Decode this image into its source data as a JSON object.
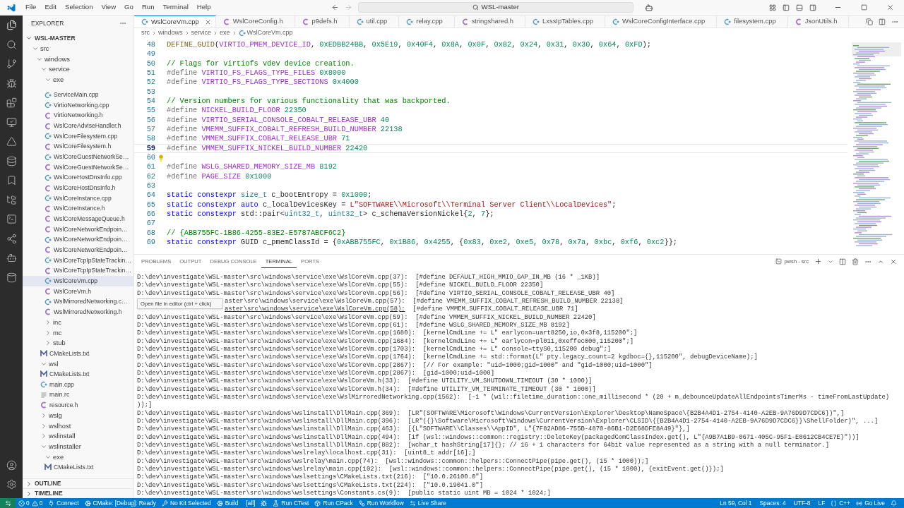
{
  "title_bar": {
    "menu": [
      "File",
      "Edit",
      "Selection",
      "View",
      "Go",
      "Run",
      "Terminal",
      "Help"
    ],
    "search": "WSL-master"
  },
  "explorer": {
    "title": "EXPLORER",
    "root": "WSL-MASTER",
    "tree": [
      {
        "name": "src",
        "kind": "folder",
        "expanded": true,
        "children": [
          {
            "name": "windows",
            "kind": "folder",
            "expanded": true,
            "children": [
              {
                "name": "service",
                "kind": "folder",
                "expanded": true,
                "children": [
                  {
                    "name": "exe",
                    "kind": "folder",
                    "expanded": true,
                    "children": [
                      {
                        "name": "ServiceMain.cpp",
                        "kind": "cpp",
                        "selected": false
                      },
                      {
                        "name": "VirtioNetworking.cpp",
                        "kind": "cpp",
                        "selected": false
                      },
                      {
                        "name": "VirtioNetworking.h",
                        "kind": "h",
                        "selected": false
                      },
                      {
                        "name": "WslCoreAdviseHandler.h",
                        "kind": "h",
                        "selected": false
                      },
                      {
                        "name": "WslCoreFilesystem.cpp",
                        "kind": "cpp",
                        "selected": false
                      },
                      {
                        "name": "WslCoreFilesystem.h",
                        "kind": "h",
                        "selected": false
                      },
                      {
                        "name": "WslCoreGuestNetworkSe…",
                        "kind": "cpp",
                        "selected": false
                      },
                      {
                        "name": "WslCoreGuestNetworkSe…",
                        "kind": "h",
                        "selected": false
                      },
                      {
                        "name": "WslCoreHostDnsInfo.cpp",
                        "kind": "cpp",
                        "selected": false
                      },
                      {
                        "name": "WslCoreHostDnsInfo.h",
                        "kind": "h",
                        "selected": false
                      },
                      {
                        "name": "WslCoreInstance.cpp",
                        "kind": "cpp",
                        "selected": false
                      },
                      {
                        "name": "WslCoreInstance.h",
                        "kind": "h",
                        "selected": false
                      },
                      {
                        "name": "WslCoreMessageQueue.h",
                        "kind": "h",
                        "selected": false
                      },
                      {
                        "name": "WslCoreNetworkEndpoin…",
                        "kind": "h",
                        "selected": false
                      },
                      {
                        "name": "WslCoreNetworkEndpoin…",
                        "kind": "cpp",
                        "selected": false
                      },
                      {
                        "name": "WslCoreNetworkEndpoin…",
                        "kind": "h",
                        "selected": false
                      },
                      {
                        "name": "WslCoreTcpIpStateTrackin…",
                        "kind": "cpp",
                        "selected": false
                      },
                      {
                        "name": "WslCoreTcpIpStateTrackin…",
                        "kind": "h",
                        "selected": false
                      },
                      {
                        "name": "WslCoreVm.cpp",
                        "kind": "cpp",
                        "selected": true
                      },
                      {
                        "name": "WslCoreVm.h",
                        "kind": "h",
                        "selected": false
                      },
                      {
                        "name": "WslMirroredNetworking.c…",
                        "kind": "cpp",
                        "selected": false
                      },
                      {
                        "name": "WslMirroredNetworking.h",
                        "kind": "h",
                        "selected": false
                      }
                    ]
                  },
                  {
                    "name": "inc",
                    "kind": "folder",
                    "expanded": false
                  },
                  {
                    "name": "mc",
                    "kind": "folder",
                    "expanded": false
                  },
                  {
                    "name": "stub",
                    "kind": "folder",
                    "expanded": false
                  },
                  {
                    "name": "CMakeLists.txt",
                    "kind": "cmake",
                    "selected": false
                  }
                ]
              },
              {
                "name": "wsl",
                "kind": "folder",
                "expanded": true,
                "children": [
                  {
                    "name": "CMakeLists.txt",
                    "kind": "cmake",
                    "selected": false
                  },
                  {
                    "name": "main.cpp",
                    "kind": "cpp",
                    "selected": false
                  },
                  {
                    "name": "main.rc",
                    "kind": "rc",
                    "selected": false
                  },
                  {
                    "name": "resource.h",
                    "kind": "h",
                    "selected": false
                  }
                ]
              },
              {
                "name": "wslg",
                "kind": "folder",
                "expanded": false
              },
              {
                "name": "wslhost",
                "kind": "folder",
                "expanded": false
              },
              {
                "name": "wslinstall",
                "kind": "folder",
                "expanded": false
              },
              {
                "name": "wslinstaller",
                "kind": "folder",
                "expanded": true,
                "children": [
                  {
                    "name": "exe",
                    "kind": "folder",
                    "expanded": true,
                    "children": [
                      {
                        "name": "CMakeLists.txt",
                        "kind": "cmake",
                        "selected": false
                      }
                    ]
                  }
                ]
              }
            ]
          }
        ]
      }
    ],
    "sections": [
      {
        "label": "OUTLINE",
        "expanded": false
      },
      {
        "label": "TIMELINE",
        "expanded": false
      }
    ]
  },
  "editor": {
    "tabs": [
      {
        "label": "WslCoreVm.cpp",
        "kind": "cpp",
        "selected": true
      },
      {
        "label": "WslCoreConfig.h",
        "kind": "h",
        "selected": false
      },
      {
        "label": "p9defs.h",
        "kind": "h",
        "selected": false
      },
      {
        "label": "util.cpp",
        "kind": "cpp",
        "selected": false
      },
      {
        "label": "relay.cpp",
        "kind": "cpp",
        "selected": false
      },
      {
        "label": "stringshared.h",
        "kind": "h",
        "selected": false
      },
      {
        "label": "LxssIpTables.cpp",
        "kind": "cpp",
        "selected": false
      },
      {
        "label": "WslCoreConfigInterface.cpp",
        "kind": "cpp",
        "selected": false
      },
      {
        "label": "filesystem.cpp",
        "kind": "cpp",
        "selected": false
      },
      {
        "label": "JsonUtils.h",
        "kind": "h",
        "selected": false
      }
    ],
    "breadcrumbs": [
      "src",
      "windows",
      "service",
      "exe",
      "WslCoreVm.cpp"
    ],
    "lines": [
      {
        "n": "48",
        "current": false,
        "tokens": [
          {
            "kind": "func",
            "text": "DEFINE_GUID"
          },
          {
            "kind": "punct",
            "text": "("
          },
          {
            "kind": "macro",
            "text": "VIRTIO_PMEM_DEVICE_ID"
          },
          {
            "kind": "punct",
            "text": ", "
          },
          {
            "kind": "num",
            "text": "0xEDBB24BB"
          },
          {
            "kind": "punct",
            "text": ", "
          },
          {
            "kind": "num",
            "text": "0x5E19"
          },
          {
            "kind": "punct",
            "text": ", "
          },
          {
            "kind": "num",
            "text": "0x40F4"
          },
          {
            "kind": "punct",
            "text": ", "
          },
          {
            "kind": "num",
            "text": "0x8A"
          },
          {
            "kind": "punct",
            "text": ", "
          },
          {
            "kind": "num",
            "text": "0x0F"
          },
          {
            "kind": "punct",
            "text": ", "
          },
          {
            "kind": "num",
            "text": "0x82"
          },
          {
            "kind": "punct",
            "text": ", "
          },
          {
            "kind": "num",
            "text": "0x24"
          },
          {
            "kind": "punct",
            "text": ", "
          },
          {
            "kind": "num",
            "text": "0x31"
          },
          {
            "kind": "punct",
            "text": ", "
          },
          {
            "kind": "num",
            "text": "0x30"
          },
          {
            "kind": "punct",
            "text": ", "
          },
          {
            "kind": "num",
            "text": "0x64"
          },
          {
            "kind": "punct",
            "text": ", "
          },
          {
            "kind": "num",
            "text": "0xFD"
          },
          {
            "kind": "punct",
            "text": ");"
          }
        ]
      },
      {
        "n": "49",
        "current": false
      },
      {
        "n": "50",
        "current": false,
        "tokens": [
          {
            "kind": "comment",
            "text": "// Flags for virtiofs vdev device creation."
          }
        ]
      },
      {
        "n": "51",
        "current": false,
        "tokens": [
          {
            "kind": "pre",
            "text": "#define"
          },
          {
            "kind": "macro",
            "text": " VIRTIO_FS_FLAGS_TYPE_FILES"
          },
          {
            "kind": "num",
            "text": " 0x8000"
          }
        ]
      },
      {
        "n": "52",
        "current": false,
        "tokens": [
          {
            "kind": "pre",
            "text": "#define"
          },
          {
            "kind": "macro",
            "text": " VIRTIO_FS_FLAGS_TYPE_SECTIONS"
          },
          {
            "kind": "num",
            "text": " 0x4000"
          }
        ]
      },
      {
        "n": "53",
        "current": false
      },
      {
        "n": "54",
        "current": false,
        "tokens": [
          {
            "kind": "comment",
            "text": "// Version numbers for various functionality that was backported."
          }
        ]
      },
      {
        "n": "55",
        "current": false,
        "tokens": [
          {
            "kind": "pre",
            "text": "#define"
          },
          {
            "kind": "macro",
            "text": " NICKEL_BUILD_FLOOR"
          },
          {
            "kind": "num",
            "text": " 22350"
          }
        ]
      },
      {
        "n": "56",
        "current": false,
        "tokens": [
          {
            "kind": "pre",
            "text": "#define"
          },
          {
            "kind": "macro",
            "text": " VIRTIO_SERIAL_CONSOLE_COBALT_RELEASE_UBR"
          },
          {
            "kind": "num",
            "text": " 40"
          }
        ]
      },
      {
        "n": "57",
        "current": false,
        "tokens": [
          {
            "kind": "pre",
            "text": "#define"
          },
          {
            "kind": "macro",
            "text": " VMEMM_SUFFIX_COBALT_REFRESH_BUILD_NUMBER"
          },
          {
            "kind": "num",
            "text": " 22138"
          }
        ]
      },
      {
        "n": "58",
        "current": false,
        "tokens": [
          {
            "kind": "pre",
            "text": "#define"
          },
          {
            "kind": "macro",
            "text": " VMMEM_SUFFIX_COBALT_RELEASE_UBR"
          },
          {
            "kind": "num",
            "text": " 71"
          }
        ]
      },
      {
        "n": "59",
        "current": true,
        "tokens": [
          {
            "kind": "pre",
            "text": "#define"
          },
          {
            "kind": "macro",
            "text": " VMMEM_SUFFIX_NICKEL_BUILD_NUMBER"
          },
          {
            "kind": "num",
            "text": " 22420"
          }
        ]
      },
      {
        "n": "60",
        "current": false,
        "bulb": true
      },
      {
        "n": "61",
        "current": false,
        "tokens": [
          {
            "kind": "pre",
            "text": "#define"
          },
          {
            "kind": "macro",
            "text": " WSLG_SHARED_MEMORY_SIZE_MB"
          },
          {
            "kind": "num",
            "text": " 8192"
          }
        ]
      },
      {
        "n": "62",
        "current": false,
        "tokens": [
          {
            "kind": "pre",
            "text": "#define"
          },
          {
            "kind": "macro",
            "text": " PAGE_SIZE"
          },
          {
            "kind": "num",
            "text": " 0x1000"
          }
        ]
      },
      {
        "n": "63",
        "current": false
      },
      {
        "n": "64",
        "current": false,
        "tokens": [
          {
            "kind": "kw",
            "text": "static constexpr "
          },
          {
            "kind": "type",
            "text": "size_t"
          },
          {
            "kind": "punct",
            "text": " c_bootEntropy = "
          },
          {
            "kind": "num",
            "text": "0x1000"
          },
          {
            "kind": "punct",
            "text": ";"
          }
        ]
      },
      {
        "n": "65",
        "current": false,
        "tokens": [
          {
            "kind": "kw",
            "text": "static constexpr auto"
          },
          {
            "kind": "punct",
            "text": " c_localDevicesKey = "
          },
          {
            "kind": "str",
            "text": "L\"SOFTWARE\\\\Microsoft\\\\Terminal Server Client\\\\LocalDevices\""
          },
          {
            "kind": "punct",
            "text": ";"
          }
        ]
      },
      {
        "n": "66",
        "current": false,
        "tokens": [
          {
            "kind": "kw",
            "text": "static constexpr"
          },
          {
            "kind": "punct",
            "text": " std::pair<"
          },
          {
            "kind": "type",
            "text": "uint32_t"
          },
          {
            "kind": "punct",
            "text": ", "
          },
          {
            "kind": "type",
            "text": "uint32_t"
          },
          {
            "kind": "punct",
            "text": "> c_schemaVersionNickel{"
          },
          {
            "kind": "num",
            "text": "2"
          },
          {
            "kind": "punct",
            "text": ", "
          },
          {
            "kind": "num",
            "text": "7"
          },
          {
            "kind": "punct",
            "text": "};"
          }
        ]
      },
      {
        "n": "67",
        "current": false
      },
      {
        "n": "68",
        "current": false,
        "tokens": [
          {
            "kind": "comment",
            "text": "// {ABB755FC-1B86-4255-83E2-E5787ABCF6C2}"
          }
        ]
      },
      {
        "n": "69",
        "current": false,
        "tokens": [
          {
            "kind": "kw",
            "text": "static constexpr"
          },
          {
            "kind": "punct",
            "text": " GUID c_pmemClassId = {"
          },
          {
            "kind": "num",
            "text": "0xABB755FC"
          },
          {
            "kind": "punct",
            "text": ", "
          },
          {
            "kind": "num",
            "text": "0x1B86"
          },
          {
            "kind": "punct",
            "text": ", "
          },
          {
            "kind": "num",
            "text": "0x4255"
          },
          {
            "kind": "punct",
            "text": ", {"
          },
          {
            "kind": "num",
            "text": "0x83"
          },
          {
            "kind": "punct",
            "text": ", "
          },
          {
            "kind": "num",
            "text": "0xe2"
          },
          {
            "kind": "punct",
            "text": ", "
          },
          {
            "kind": "num",
            "text": "0xe5"
          },
          {
            "kind": "punct",
            "text": ", "
          },
          {
            "kind": "num",
            "text": "0x78"
          },
          {
            "kind": "punct",
            "text": ", "
          },
          {
            "kind": "num",
            "text": "0x7a"
          },
          {
            "kind": "punct",
            "text": ", "
          },
          {
            "kind": "num",
            "text": "0xbc"
          },
          {
            "kind": "punct",
            "text": ", "
          },
          {
            "kind": "num",
            "text": "0xf6"
          },
          {
            "kind": "punct",
            "text": ", "
          },
          {
            "kind": "num",
            "text": "0xc2"
          },
          {
            "kind": "punct",
            "text": "}};"
          }
        ]
      }
    ]
  },
  "panel": {
    "tabs": [
      {
        "label": "PROBLEMS",
        "selected": false
      },
      {
        "label": "OUTPUT",
        "selected": false
      },
      {
        "label": "DEBUG CONSOLE",
        "selected": false
      },
      {
        "label": "TERMINAL",
        "selected": true
      },
      {
        "label": "PORTS",
        "selected": false
      }
    ],
    "shell": "pwsh - src",
    "tooltip": "Open file in editor (ctrl + click)",
    "lines": [
      {
        "kind": "line",
        "path": "D:\\dev\\investigate\\WSL-master\\src\\windows\\service\\exe\\WslCoreVm.cpp(37):",
        "text": "[#define DEFAULT_HIGH_MMIO_GAP_IN_MB (16 * _1KB)]"
      },
      {
        "kind": "line",
        "path": "D:\\dev\\investigate\\WSL-master\\src\\windows\\service\\exe\\WslCoreVm.cpp(55):",
        "text": "[#define NICKEL_BUILD_FLOOR 22350]"
      },
      {
        "kind": "line",
        "path": "D:\\dev\\investigate\\WSL-master\\src\\windows\\service\\exe\\WslCoreVm.cpp(56):",
        "text": "[#define VIRTIO_SERIAL_CONSOLE_COBALT_RELEASE_UBR 40]"
      },
      {
        "kind": "covered",
        "path": "aster\\src\\windows\\service\\exe\\WslCoreVm.cpp(57):",
        "text": "[#define VMEMM_SUFFIX_COBALT_REFRESH_BUILD_NUMBER 22138]"
      },
      {
        "kind": "covered_link",
        "path": "aster\\src\\windows\\service\\exe\\WslCoreVm.cpp(58):",
        "text": "[#define VMMEM_SUFFIX_COBALT_RELEASE_UBR 71]"
      },
      {
        "kind": "line",
        "path": "D:\\dev\\investigate\\WSL-master\\src\\windows\\service\\exe\\WslCoreVm.cpp(59):",
        "text": "[#define VMMEM_SUFFIX_NICKEL_BUILD_NUMBER 22420]"
      },
      {
        "kind": "line",
        "path": "D:\\dev\\investigate\\WSL-master\\src\\windows\\service\\exe\\WslCoreVm.cpp(61):",
        "text": "[#define WSLG_SHARED_MEMORY_SIZE_MB 8192]"
      },
      {
        "kind": "line",
        "path": "D:\\dev\\investigate\\WSL-master\\src\\windows\\service\\exe\\WslCoreVm.cpp(1680):",
        "text": "[kernelCmdLine += L\" earlycon=uart8250,io,0x3f8,115200\";]"
      },
      {
        "kind": "line",
        "path": "D:\\dev\\investigate\\WSL-master\\src\\windows\\service\\exe\\WslCoreVm.cpp(1684):",
        "text": "[kernelCmdLine += L\" earlycon=pl011,0xeffec000,115200\";]"
      },
      {
        "kind": "line",
        "path": "D:\\dev\\investigate\\WSL-master\\src\\windows\\service\\exe\\WslCoreVm.cpp(1703):",
        "text": "[kernelCmdLine += L\" console=ttyS0,115200 debug\";]"
      },
      {
        "kind": "line",
        "path": "D:\\dev\\investigate\\WSL-master\\src\\windows\\service\\exe\\WslCoreVm.cpp(1764):",
        "text": "[kernelCmdLine += std::format(L\" pty.legacy_count=2 kgdboc={},115200\", debugDeviceName);]"
      },
      {
        "kind": "line",
        "path": "D:\\dev\\investigate\\WSL-master\\src\\windows\\service\\exe\\WslCoreVm.cpp(2867):",
        "text": "[// For example: \"uid=1000;gid=1000\" and \"gid=1000;uid=1000\"]"
      },
      {
        "kind": "line",
        "path": "D:\\dev\\investigate\\WSL-master\\src\\windows\\service\\exe\\WslCoreVm.cpp(2867):",
        "text": "[gid=1000;uid=1000]"
      },
      {
        "kind": "line",
        "path": "D:\\dev\\investigate\\WSL-master\\src\\windows\\service\\exe\\WslCoreVm.h(33):",
        "text": "[#define UTILITY_VM_SHUTDOWN_TIMEOUT (30 * 1000)]"
      },
      {
        "kind": "line",
        "path": "D:\\dev\\investigate\\WSL-master\\src\\windows\\service\\exe\\WslCoreVm.h(34):",
        "text": "[#define UTILITY_VM_TERMINATE_TIMEOUT (30 * 1000)]"
      },
      {
        "kind": "line",
        "path": "D:\\dev\\investigate\\WSL-master\\src\\windows\\service\\exe\\WslMirroredNetworking.cpp(1562):",
        "text": "[-1 * (wil::filetime_duration::one_millisecond * (20 + m_debounceUpdateAllEndpointsTimerMs - timeFromLastUpdate)"
      },
      {
        "kind": "line",
        "text": "));]"
      },
      {
        "kind": "line",
        "path": "D:\\dev\\investigate\\WSL-master\\src\\windows\\wslinstall\\DllMain.cpp(369):",
        "text": "[LR\"(SOFTWARE\\Microsoft\\Windows\\CurrentVersion\\Explorer\\Desktop\\NameSpace\\{B2B4A4D1-2754-4140-A2EB-9A76D9D7CDC6})\",]"
      },
      {
        "kind": "line",
        "path": "D:\\dev\\investigate\\WSL-master\\src\\windows\\wslinstall\\DllMain.cpp(396):",
        "text": "[LR\"({}\\Software\\Microsoft\\Windows\\CurrentVersion\\Explorer\\CLSID\\{{B2B4A4D1-2754-4140-A2EB-9A76D9D7CDC6}}\\ShellFolder)\", ...]"
      },
      {
        "kind": "line",
        "path": "D:\\dev\\investigate\\WSL-master\\src\\windows\\wslinstall\\DllMain.cpp(463):",
        "text": "[{L\"SOFTWARE\\\\Classes\\\\AppID\", L\"{7F82AD86-755B-4870-86B1-D2E68DFE8A49}\"},]"
      },
      {
        "kind": "line",
        "path": "D:\\dev\\investigate\\WSL-master\\src\\windows\\wslinstall\\DllMain.cpp(494):",
        "text": "[if (wsl::windows::common::registry::DeleteKey(packagedComClassIndex.get(), L\"{A9B7A1B9-0671-405C-95F1-E0612CB4CE7E}\"))]"
      },
      {
        "kind": "line",
        "path": "D:\\dev\\investigate\\WSL-master\\src\\windows\\wslinstall\\DllMain.cpp(882):",
        "text": "[wchar_t hashString[17]{}; // 16 + 1 characters for 64bit value represented as a string with a null terminator.]"
      },
      {
        "kind": "line",
        "path": "D:\\dev\\investigate\\WSL-master\\src\\windows\\wslrelay\\localhost.cpp(31):",
        "text": "[uint8_t addr[16];]"
      },
      {
        "kind": "line",
        "path": "D:\\dev\\investigate\\WSL-master\\src\\windows\\wslrelay\\main.cpp(74):",
        "text": "[wsl::windows::common::helpers::ConnectPipe(pipe.get(), (15 * 1000));]"
      },
      {
        "kind": "line",
        "path": "D:\\dev\\investigate\\WSL-master\\src\\windows\\wslrelay\\main.cpp(102):",
        "text": "[wsl::windows::common::helpers::ConnectPipe(pipe.get(), (15 * 1000), {exitEvent.get()});]"
      },
      {
        "kind": "line",
        "path": "D:\\dev\\investigate\\WSL-master\\src\\windows\\wslsettings\\CMakeLists.txt(216):",
        "text": "[\"10.0.26100.0\"]"
      },
      {
        "kind": "line",
        "path": "D:\\dev\\investigate\\WSL-master\\src\\windows\\wslsettings\\CMakeLists.txt(224):",
        "text": "[\"10.0.19041.0\"]"
      },
      {
        "kind": "line",
        "path": "D:\\dev\\investigate\\WSL-master\\src\\windows\\wslsettings\\Constants.cs(9):",
        "text": "[public static uint MB = 1024 * 1024;]"
      }
    ]
  },
  "status_bar": {
    "left": [
      {
        "kind": "problems",
        "errors": "0",
        "warnings": "0"
      },
      {
        "kind": "connect",
        "label": "Connect"
      },
      {
        "kind": "cmake",
        "label": "CMake: [Debug]: Ready"
      },
      {
        "kind": "kit",
        "label": "No Kit Selected"
      },
      {
        "kind": "build",
        "label": "Build"
      },
      {
        "kind": "plain",
        "label": "[all]"
      },
      {
        "kind": "debug"
      },
      {
        "kind": "ctest",
        "label": "Run CTest"
      },
      {
        "kind": "cpack",
        "label": "Run CPack"
      },
      {
        "kind": "workflow",
        "label": "Run Workflow"
      },
      {
        "kind": "share",
        "label": "Live Share"
      }
    ],
    "right": [
      {
        "kind": "plain",
        "label": "Ln 59, Col 1"
      },
      {
        "kind": "plain",
        "label": "Spaces: 4"
      },
      {
        "kind": "plain",
        "label": "UTF-8"
      },
      {
        "kind": "plain",
        "label": "LF"
      },
      {
        "kind": "lang",
        "label": "C++"
      },
      {
        "kind": "live",
        "label": "Go Live"
      },
      {
        "kind": "bell"
      }
    ]
  }
}
